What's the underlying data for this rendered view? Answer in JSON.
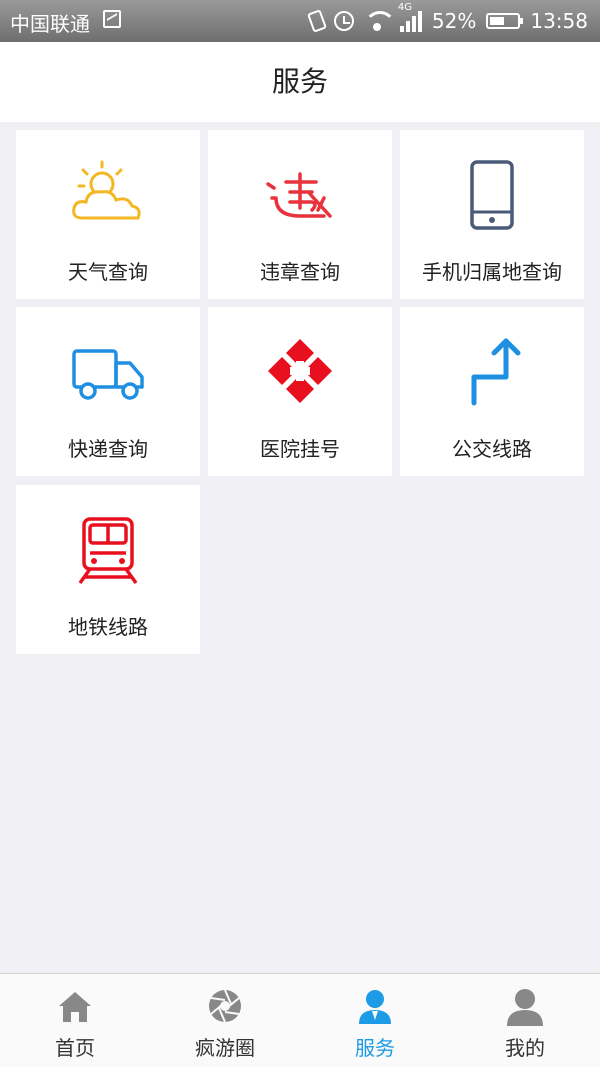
{
  "status_bar": {
    "carrier": "中国联通",
    "network": "4G",
    "battery": "52%",
    "time": "13:58"
  },
  "header": {
    "title": "服务"
  },
  "services": [
    {
      "label": "天气查询",
      "icon": "weather-icon",
      "color": "#f2b722"
    },
    {
      "label": "违章查询",
      "icon": "violation-icon",
      "color": "#e8323c"
    },
    {
      "label": "手机归属地查询",
      "icon": "phone-icon",
      "color": "#4a5a78"
    },
    {
      "label": "快递查询",
      "icon": "truck-icon",
      "color": "#1e8fe1"
    },
    {
      "label": "医院挂号",
      "icon": "hospital-icon",
      "color": "#e8101e"
    },
    {
      "label": "公交线路",
      "icon": "route-icon",
      "color": "#1e8fe1"
    },
    {
      "label": "地铁线路",
      "icon": "metro-icon",
      "color": "#e8101e"
    }
  ],
  "tabbar": {
    "tabs": [
      {
        "label": "首页",
        "icon": "home-icon",
        "active": false
      },
      {
        "label": "疯游圈",
        "icon": "aperture-icon",
        "active": false
      },
      {
        "label": "服务",
        "icon": "service-person-icon",
        "active": true
      },
      {
        "label": "我的",
        "icon": "profile-icon",
        "active": false
      }
    ],
    "active_color": "#1e9be6",
    "inactive_color": "#888888"
  }
}
